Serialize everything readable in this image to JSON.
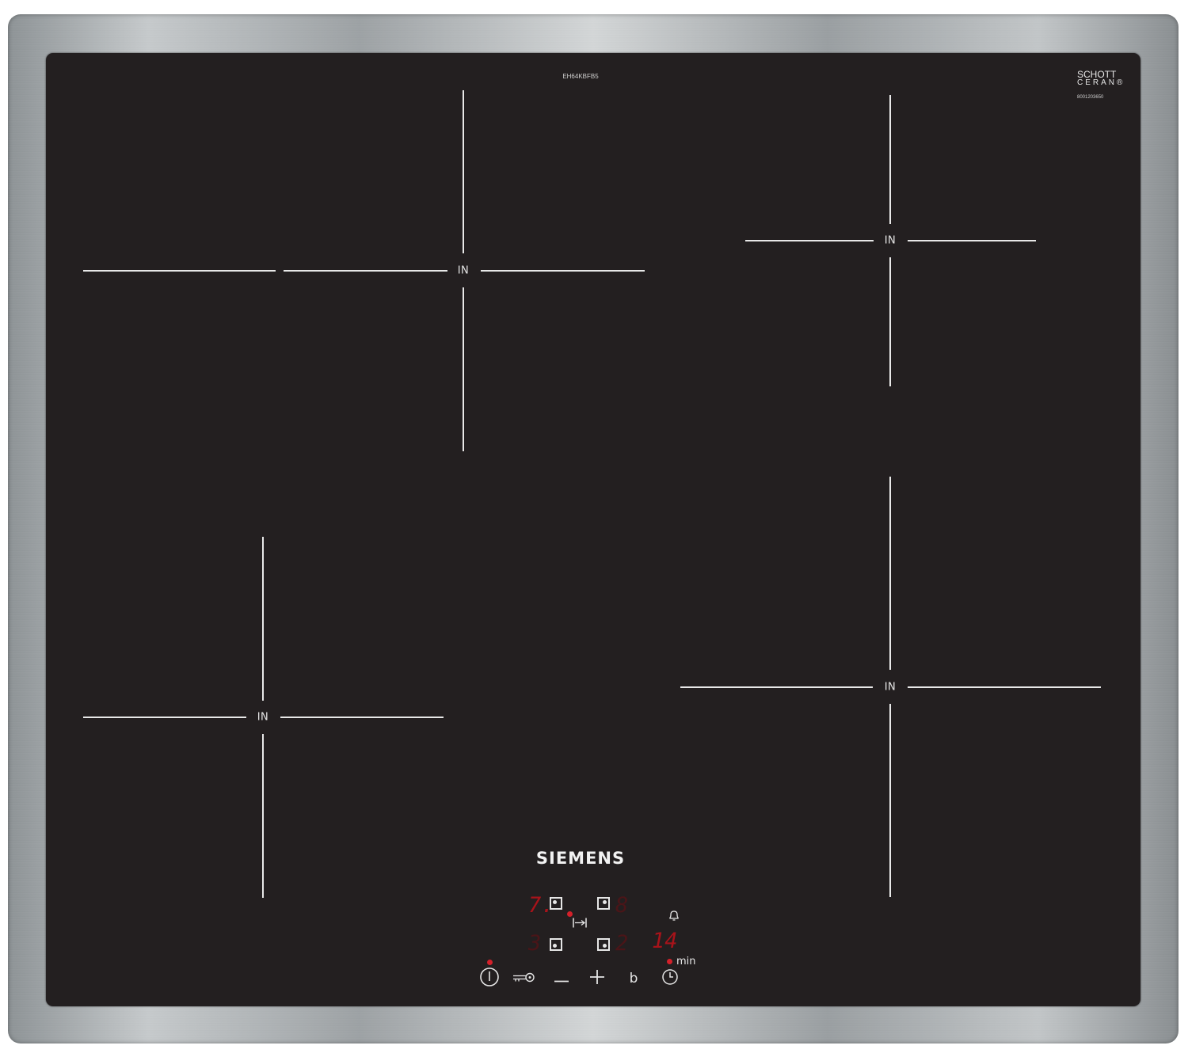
{
  "cooktop": {
    "model": "EH64KBFB5",
    "brand": "SIEMENS",
    "glass_maker_line1": "SCHOTT",
    "glass_maker_line2": "CERAN®",
    "glass_code": "8001203650",
    "zones": [
      {
        "id": "rear-left",
        "label": "IN"
      },
      {
        "id": "rear-right",
        "label": "IN"
      },
      {
        "id": "front-left",
        "label": "IN"
      },
      {
        "id": "front-right",
        "label": "IN"
      }
    ]
  },
  "control_panel": {
    "displays": {
      "rear_left_level": "7.",
      "rear_right_level": "8",
      "front_left_level": "3",
      "front_right_level": "2",
      "timer_value": "14",
      "timer_unit": "min"
    },
    "buttons": [
      {
        "id": "power",
        "icon": "power-icon"
      },
      {
        "id": "child-lock",
        "icon": "key-icon"
      },
      {
        "id": "minus",
        "icon": "minus-icon"
      },
      {
        "id": "plus",
        "icon": "plus-icon"
      },
      {
        "id": "booster",
        "label": "b"
      },
      {
        "id": "timer",
        "icon": "clock-icon"
      }
    ],
    "colors": {
      "led_active": "#a8131a",
      "led_dim": "#4a1518",
      "glass": "#231f20"
    }
  }
}
